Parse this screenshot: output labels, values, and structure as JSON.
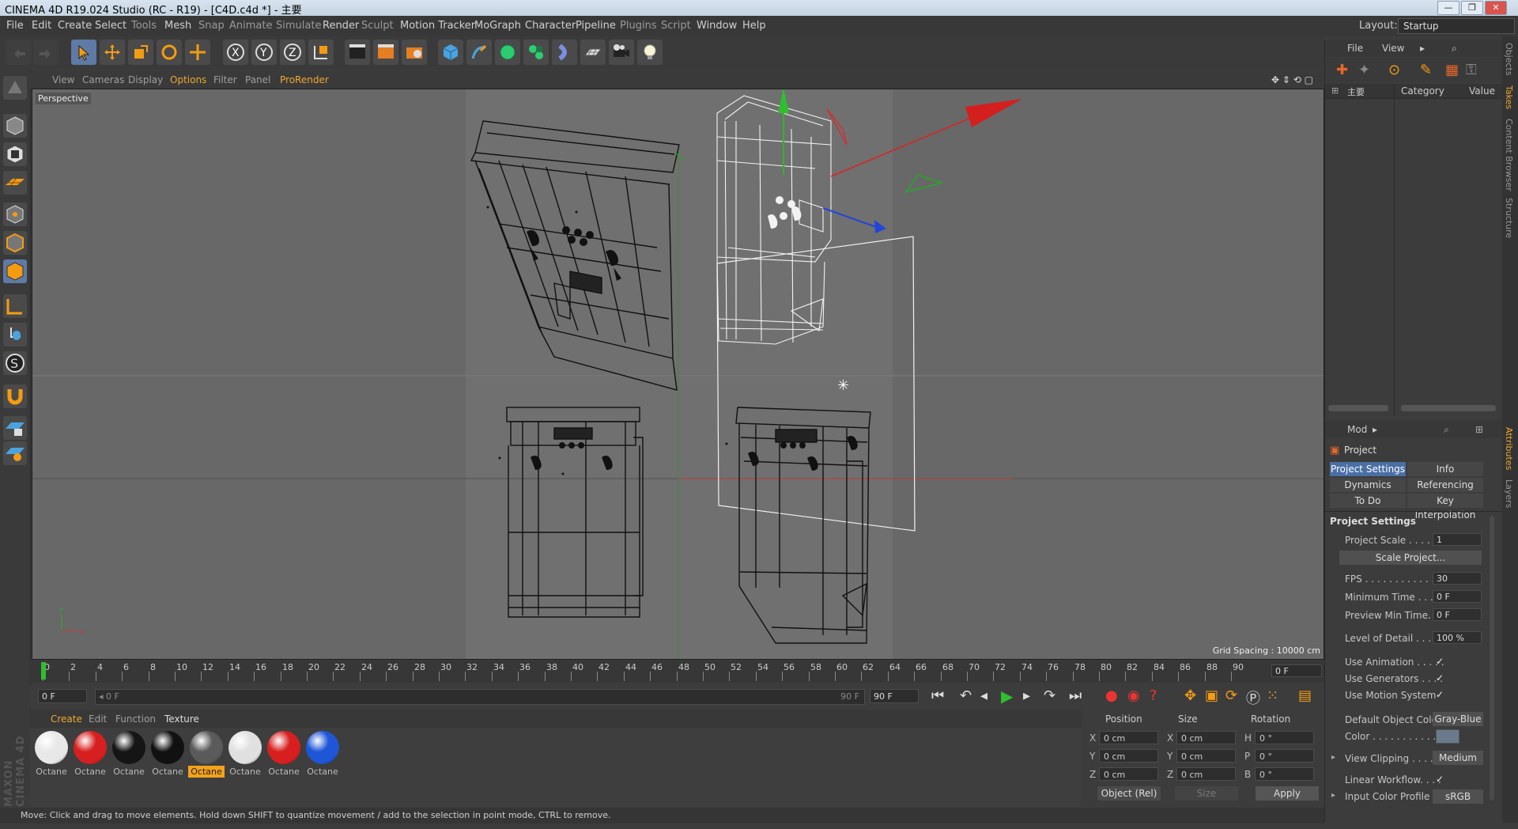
{
  "window": {
    "title": "CINEMA 4D R19.024 Studio (RC - R19) - [C4D.c4d *] - 主要",
    "minimize": "—",
    "maximize": "❐",
    "close": "✕"
  },
  "menu": [
    "File",
    "Edit",
    "Create",
    "Select",
    "Tools",
    "Mesh",
    "Snap",
    "Animate",
    "Simulate",
    "Render",
    "Sculpt",
    "Motion Tracker",
    "MoGraph",
    "Character",
    "Pipeline",
    "Plugins",
    "Script",
    "Window",
    "Help"
  ],
  "layout": {
    "label": "Layout:",
    "value": "Startup"
  },
  "viewport": {
    "menu": [
      "View",
      "Cameras",
      "Display",
      "Options",
      "Filter",
      "Panel",
      "ProRender"
    ],
    "camera_label": "Perspective",
    "grid_spacing": "Grid Spacing : 10000 cm"
  },
  "timeline": {
    "ticks": [
      "0",
      "2",
      "4",
      "6",
      "8",
      "10",
      "12",
      "14",
      "16",
      "18",
      "20",
      "22",
      "24",
      "26",
      "28",
      "30",
      "32",
      "34",
      "36",
      "38",
      "40",
      "42",
      "44",
      "46",
      "48",
      "50",
      "52",
      "54",
      "56",
      "58",
      "60",
      "62",
      "64",
      "66",
      "68",
      "70",
      "72",
      "74",
      "76",
      "78",
      "80",
      "82",
      "84",
      "86",
      "88",
      "90"
    ],
    "current_frame": "0 F",
    "start_field": "0 F",
    "range_start": "◂ 0 F",
    "range_end": "90 F",
    "end_field": "90 F"
  },
  "materials": {
    "menu": [
      "Create",
      "Edit",
      "Function",
      "Texture"
    ],
    "items": [
      {
        "name": "Octane",
        "color": "#e8e8e8",
        "selected": false
      },
      {
        "name": "Octane",
        "color": "#d81f1f",
        "selected": false
      },
      {
        "name": "Octane",
        "color": "#151515",
        "selected": false
      },
      {
        "name": "Octane",
        "color": "#111111",
        "selected": false
      },
      {
        "name": "Octane",
        "color": "#5a5a5a",
        "selected": true
      },
      {
        "name": "Octane",
        "color": "#e0e0e0",
        "selected": false
      },
      {
        "name": "Octane",
        "color": "#d81f1f",
        "selected": false
      },
      {
        "name": "Octane",
        "color": "#1f56d8",
        "selected": false
      }
    ]
  },
  "coords": {
    "headers": {
      "position": "Position",
      "size": "Size",
      "rotation": "Rotation"
    },
    "axes": [
      "X",
      "Y",
      "Z"
    ],
    "rot_axes": [
      "H",
      "P",
      "B"
    ],
    "pos_values": [
      "0 cm",
      "0 cm",
      "0 cm"
    ],
    "size_values": [
      "0 cm",
      "0 cm",
      "0 cm"
    ],
    "rot_values": [
      "0 °",
      "0 °",
      "0 °"
    ],
    "mode": "Object (Rel)",
    "size_mode": "Size",
    "apply": "Apply"
  },
  "status": "Move: Click and drag to move elements. Hold down SHIFT to quantize movement / add to the selection in point mode, CTRL to remove.",
  "logo": "MAXON CINEMA 4D",
  "objects": {
    "menu": [
      "File",
      "View"
    ],
    "tree_item": "主要",
    "col_category": "Category",
    "col_value": "Value"
  },
  "attributes": {
    "mode": "Mod",
    "title": "Project",
    "tabs": [
      {
        "label": "Project Settings",
        "on": true
      },
      {
        "label": "Info",
        "on": false
      },
      {
        "label": "Dynamics",
        "on": false
      },
      {
        "label": "Referencing",
        "on": false
      },
      {
        "label": "To Do",
        "on": false
      },
      {
        "label": "Key Interpolation",
        "on": false
      }
    ],
    "section": "Project Settings",
    "project_scale": {
      "label": "Project Scale . . . . . .",
      "value": "1"
    },
    "scale_button": "Scale Project...",
    "fps": {
      "label": "FPS . . . . . . . . . . . . . .",
      "value": "30"
    },
    "min_time": {
      "label": "Minimum Time . . . .",
      "value": "0 F"
    },
    "preview_min": {
      "label": "Preview Min Time. . .",
      "value": "0 F"
    },
    "lod": {
      "label": "Level of Detail . . . . .",
      "value": "100 %"
    },
    "use_animation": {
      "label": "Use Animation . . . . .",
      "value": "✓"
    },
    "use_generators": {
      "label": "Use Generators . . . .",
      "value": "✓"
    },
    "use_motion": {
      "label": "Use Motion System",
      "value": "✓"
    },
    "default_color": {
      "label": "Default Object Color",
      "value": "Gray-Blue"
    },
    "color": {
      "label": "Color . . . . . . . . . . ."
    },
    "view_clipping": {
      "label": "View Clipping . . . . .",
      "value": "Medium"
    },
    "linear_workflow": {
      "label": "Linear Workflow. . . .",
      "value": "✓"
    },
    "input_profile": {
      "label": "Input Color Profile . .",
      "value": "sRGB"
    }
  },
  "sidetabs": [
    "Objects",
    "Takes",
    "Content Browser",
    "Structure",
    "Attributes",
    "Layers"
  ]
}
